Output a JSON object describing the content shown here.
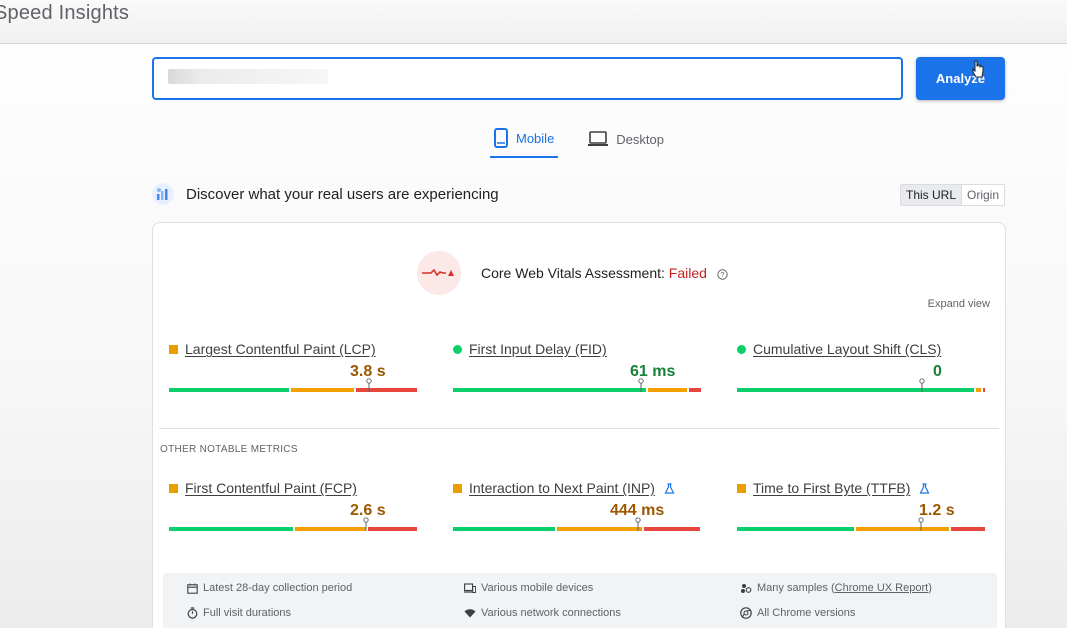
{
  "header": {
    "app_title": "Speed Insights"
  },
  "search": {
    "value": "",
    "placeholder": ""
  },
  "analyze_label": "Analyze",
  "tabs": [
    {
      "label": "Mobile",
      "icon": "smartphone-icon",
      "active": true
    },
    {
      "label": "Desktop",
      "icon": "laptop-icon",
      "active": false
    }
  ],
  "discover": {
    "text": "Discover what your real users are experiencing",
    "scope_options": [
      "This URL",
      "Origin"
    ],
    "scope_selected": "This URL"
  },
  "assessment": {
    "label": "Core Web Vitals Assessment: ",
    "status": "Failed",
    "expand_label": "Expand view"
  },
  "core_metrics": [
    {
      "name": "Largest Contentful Paint (LCP)",
      "value": "3.8 s",
      "rating": "needs-improvement",
      "indicator": "square",
      "dist": [
        49,
        26,
        25
      ]
    },
    {
      "name": "First Input Delay (FID)",
      "value": "61 ms",
      "rating": "good",
      "indicator": "circle",
      "dist": [
        79,
        16,
        5
      ]
    },
    {
      "name": "Cumulative Layout Shift (CLS)",
      "value": "0",
      "rating": "good",
      "indicator": "circle",
      "dist": [
        97,
        2,
        1
      ]
    }
  ],
  "other_metrics_label": "OTHER NOTABLE METRICS",
  "other_metrics": [
    {
      "name": "First Contentful Paint (FCP)",
      "value": "2.6 s",
      "rating": "needs-improvement",
      "indicator": "square",
      "experimental": false,
      "dist": [
        51,
        29,
        20
      ]
    },
    {
      "name": "Interaction to Next Paint (INP)",
      "value": "444 ms",
      "rating": "needs-improvement",
      "indicator": "square",
      "experimental": true,
      "dist": [
        42,
        35,
        23
      ]
    },
    {
      "name": "Time to First Byte (TTFB)",
      "value": "1.2 s",
      "rating": "needs-improvement",
      "indicator": "square",
      "experimental": true,
      "dist": [
        48,
        38,
        14
      ]
    }
  ],
  "info": [
    {
      "icon": "calendar-icon",
      "text": "Latest 28-day collection period"
    },
    {
      "icon": "devices-icon",
      "text": "Various mobile devices"
    },
    {
      "icon": "samples-icon",
      "text": "Many samples (",
      "link": "Chrome UX Report",
      "suffix": ")"
    },
    {
      "icon": "timer-icon",
      "text": "Full visit durations"
    },
    {
      "icon": "wifi-icon",
      "text": "Various network connections"
    },
    {
      "icon": "chrome-icon",
      "text": "All Chrome versions"
    }
  ],
  "colors": {
    "accent": "#1a73e8",
    "good": "#0cce6b",
    "average": "#f4a000",
    "poor": "#e8453c",
    "failed": "#c5221f"
  }
}
